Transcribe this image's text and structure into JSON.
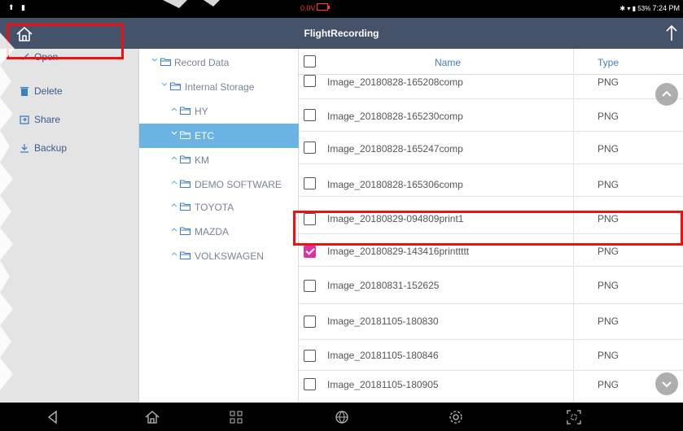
{
  "status_bar": {
    "left_icons": "⬆ ▮",
    "voltage": "0.0V",
    "right_text": "✱ ▾ ▮ 53%",
    "time": "7:24 PM"
  },
  "header": {
    "title": "FlightRecording",
    "home_icon": "home-icon",
    "upload_icon": "upload-icon"
  },
  "sidebar": {
    "items": [
      {
        "label": "Open",
        "icon": "check-icon"
      },
      {
        "label": "Delete",
        "icon": "trash-icon"
      },
      {
        "label": "Share",
        "icon": "share-icon"
      },
      {
        "label": "Backup",
        "icon": "download-icon"
      }
    ]
  },
  "tree": {
    "root": "Record Data",
    "storage": "Internal Storage",
    "folders": [
      "HY",
      "ETC",
      "KM",
      "DEMO SOFTWARE",
      "TOYOTA",
      "MAZDA",
      "VOLKSWAGEN"
    ],
    "selected": "ETC"
  },
  "list": {
    "header_name": "Name",
    "header_type": "Type",
    "rows": [
      {
        "name": "Image_20180828-165208comp",
        "type": "PNG",
        "checked": false
      },
      {
        "name": "Image_20180828-165230comp",
        "type": "PNG",
        "checked": false
      },
      {
        "name": "Image_20180828-165247comp",
        "type": "PNG",
        "checked": false
      },
      {
        "name": "Image_20180828-165306comp",
        "type": "PNG",
        "checked": false
      },
      {
        "name": "Image_20180829-094809print1",
        "type": "PNG",
        "checked": false
      },
      {
        "name": "Image_20180829-143416printtttt",
        "type": "PNG",
        "checked": true
      },
      {
        "name": "Image_20180831-152625",
        "type": "PNG",
        "checked": false
      },
      {
        "name": "Image_20181105-180830",
        "type": "PNG",
        "checked": false
      },
      {
        "name": "Image_20181105-180846",
        "type": "PNG",
        "checked": false
      },
      {
        "name": "Image_20181105-180905",
        "type": "PNG",
        "checked": false
      }
    ]
  },
  "colors": {
    "title_bar": "#44536a",
    "selected_node": "#6ab3e2",
    "checkbox_checked": "#e0309a",
    "highlight": "#ee1111"
  },
  "nav_bar": {
    "icons": [
      "back-icon",
      "home-icon",
      "apps-icon",
      "browser-icon",
      "settings-icon",
      "screenshot-icon"
    ]
  }
}
